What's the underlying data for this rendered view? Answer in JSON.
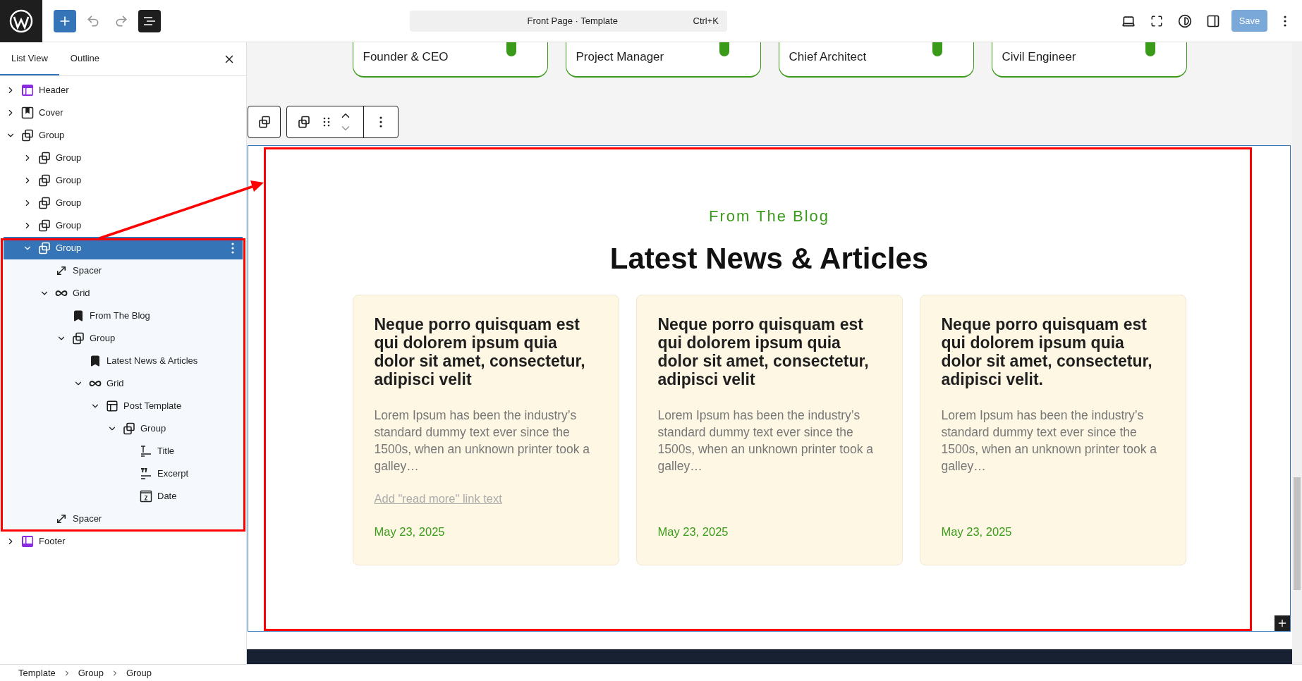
{
  "topbar": {
    "command_bar": {
      "title": "Front Page · Template",
      "shortcut": "Ctrl+K"
    },
    "list_view_open": true,
    "save_button": {
      "label": "Save",
      "disabled": true
    }
  },
  "sidebar": {
    "tabs": [
      {
        "label": "List View",
        "selected": true
      },
      {
        "label": "Outline",
        "selected": false
      }
    ],
    "tree": [
      {
        "label": "Header",
        "kind": "template-part",
        "expanded": false,
        "selected": false
      },
      {
        "label": "Cover",
        "kind": "cover",
        "expanded": false,
        "selected": false
      },
      {
        "label": "Group",
        "kind": "group",
        "expanded": true,
        "selected": false,
        "children": [
          {
            "label": "Group",
            "kind": "group",
            "expanded": false,
            "selected": false
          },
          {
            "label": "Group",
            "kind": "group",
            "expanded": false,
            "selected": false
          },
          {
            "label": "Group",
            "kind": "group",
            "expanded": false,
            "selected": false
          },
          {
            "label": "Group",
            "kind": "group",
            "expanded": false,
            "selected": false
          },
          {
            "label": "Group",
            "kind": "group",
            "expanded": true,
            "selected": true,
            "children": [
              {
                "label": "Spacer",
                "kind": "spacer",
                "selected": false
              },
              {
                "label": "Grid",
                "kind": "grid",
                "expanded": true,
                "selected": false,
                "children": [
                  {
                    "label": "From The Blog",
                    "kind": "heading",
                    "selected": false
                  },
                  {
                    "label": "Group",
                    "kind": "group",
                    "expanded": true,
                    "selected": false,
                    "children": [
                      {
                        "label": "Latest News & Articles",
                        "kind": "heading",
                        "selected": false
                      },
                      {
                        "label": "Grid",
                        "kind": "grid",
                        "expanded": true,
                        "selected": false,
                        "children": [
                          {
                            "label": "Post Template",
                            "kind": "post-template",
                            "expanded": true,
                            "selected": false,
                            "children": [
                              {
                                "label": "Group",
                                "kind": "group",
                                "expanded": true,
                                "selected": false,
                                "children": [
                                  {
                                    "label": "Title",
                                    "kind": "title",
                                    "selected": false
                                  },
                                  {
                                    "label": "Excerpt",
                                    "kind": "excerpt",
                                    "selected": false
                                  },
                                  {
                                    "label": "Date",
                                    "kind": "date",
                                    "selected": false
                                  }
                                ]
                              }
                            ]
                          }
                        ]
                      }
                    ]
                  }
                ]
              },
              {
                "label": "Spacer",
                "kind": "spacer",
                "selected": false
              }
            ]
          }
        ]
      },
      {
        "label": "Footer",
        "kind": "template-part-footer",
        "expanded": false,
        "selected": false
      }
    ]
  },
  "canvas": {
    "team_cards": [
      {
        "role": "Founder & CEO"
      },
      {
        "role": "Project Manager"
      },
      {
        "role": "Chief Architect"
      },
      {
        "role": "Civil Engineer"
      }
    ],
    "section": {
      "eyebrow": "From The Blog",
      "heading": "Latest News & Articles",
      "posts": [
        {
          "title": "Neque porro quisquam est qui dolorem ipsum quia dolor sit amet, consectetur, adipisci velit",
          "excerpt": "Lorem Ipsum has been the industry’s standard dummy text ever since the 1500s, when an unknown printer took a galley…",
          "read_more": "Add \"read more\" link text",
          "date": "May 23, 2025"
        },
        {
          "title": "Neque porro quisquam est qui dolorem ipsum quia dolor sit amet, consectetur, adipisci velit",
          "excerpt": "Lorem Ipsum has been the industry’s standard dummy text ever since the 1500s, when an unknown printer took a galley…",
          "date": "May 23, 2025"
        },
        {
          "title": "Neque porro quisquam est qui dolorem ipsum quia dolor sit amet, consectetur, adipisci velit.",
          "excerpt": "Lorem Ipsum has been the industry’s standard dummy text ever since the 1500s, when an unknown printer took a galley…",
          "date": "May 23, 2025"
        }
      ]
    }
  },
  "breadcrumb": [
    "Template",
    "Group",
    "Group"
  ]
}
